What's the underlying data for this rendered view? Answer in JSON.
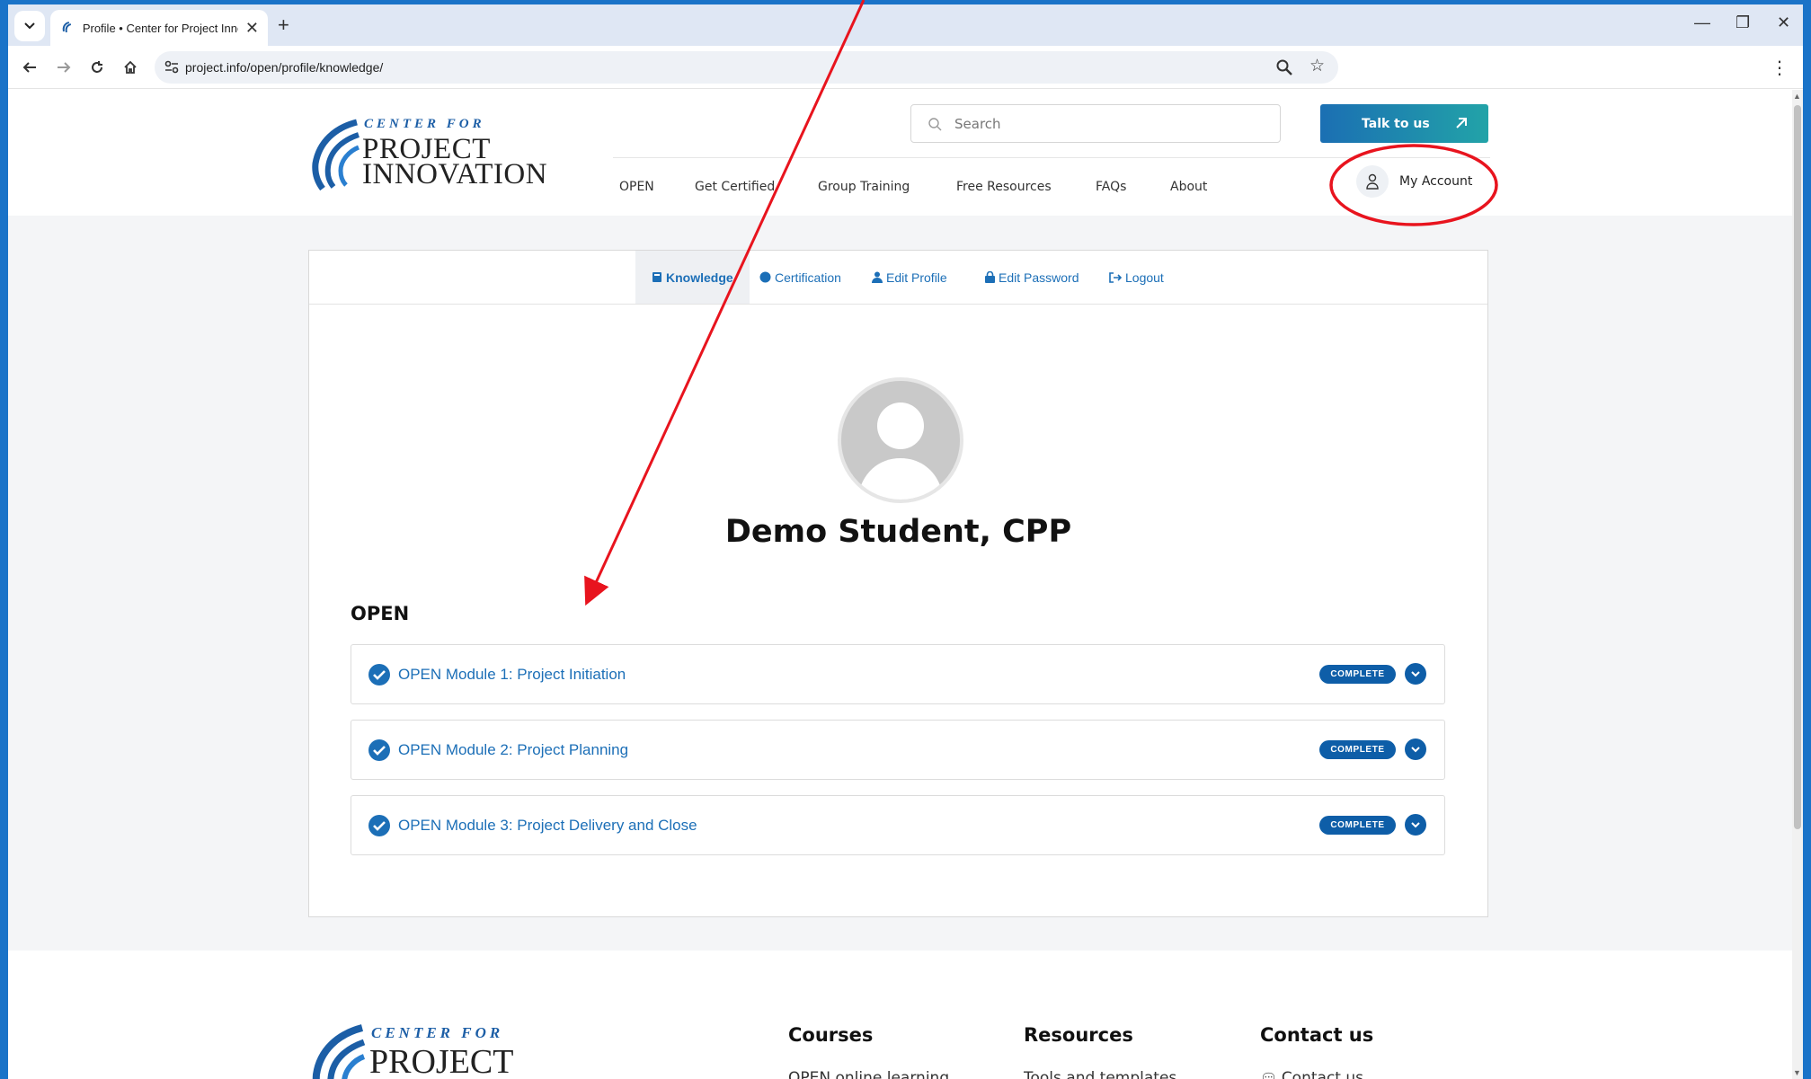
{
  "browser": {
    "tab_title": "Profile • Center for Project Inno",
    "url": "project.info/open/profile/knowledge/"
  },
  "header": {
    "logo": {
      "center_for": "CENTER FOR",
      "line1": "PROJECT",
      "line2": "INNOVATION"
    },
    "search_placeholder": "Search",
    "cta_label": "Talk to us",
    "nav": [
      "OPEN",
      "Get Certified",
      "Group Training",
      "Free Resources",
      "FAQs",
      "About"
    ],
    "account_label": "My Account"
  },
  "profile": {
    "tabs": [
      "Knowledge",
      "Certification",
      "Edit Profile",
      "Edit Password",
      "Logout"
    ],
    "active_tab": "Knowledge",
    "student_name": "Demo Student, CPP",
    "section_title": "OPEN",
    "modules": [
      {
        "title": "OPEN Module 1: Project Initiation",
        "status": "COMPLETE"
      },
      {
        "title": "OPEN Module 2: Project Planning",
        "status": "COMPLETE"
      },
      {
        "title": "OPEN Module 3: Project Delivery and Close",
        "status": "COMPLETE"
      }
    ]
  },
  "footer": {
    "columns": [
      {
        "heading": "Courses",
        "links": [
          "OPEN online learning"
        ]
      },
      {
        "heading": "Resources",
        "links": [
          "Tools and templates"
        ]
      },
      {
        "heading": "Contact us",
        "links": [
          "Contact us"
        ]
      }
    ]
  },
  "colors": {
    "brand_blue": "#1c6fb7",
    "badge_blue": "#0e5ea8",
    "annotation_red": "#e8141e",
    "frame_blue": "#1a73c8"
  }
}
